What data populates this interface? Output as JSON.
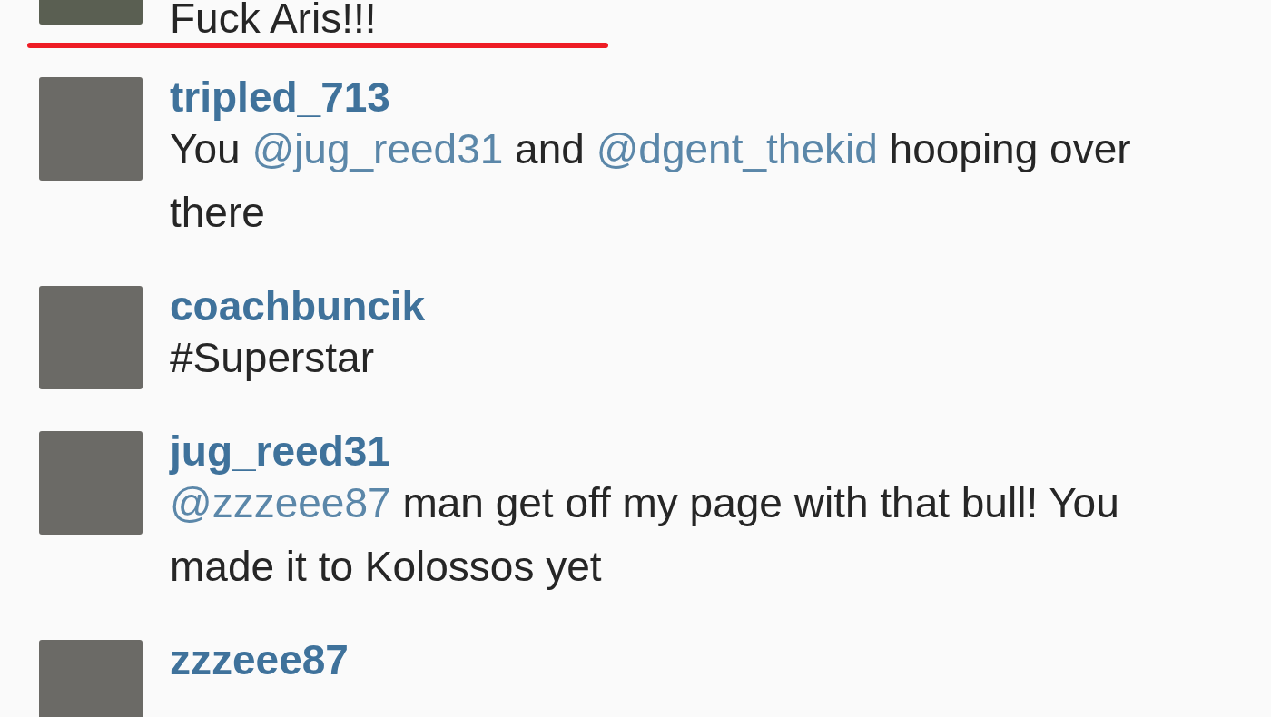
{
  "comments": [
    {
      "body": [
        {
          "kind": "text",
          "text": "Fuck Aris!!!"
        }
      ]
    },
    {
      "username": "tripled_713",
      "body": [
        {
          "kind": "text",
          "text": "You "
        },
        {
          "kind": "mention",
          "text": "@jug_reed31"
        },
        {
          "kind": "text",
          "text": " and "
        },
        {
          "kind": "mention",
          "text": "@dgent_thekid"
        },
        {
          "kind": "text",
          "text": " hooping over there"
        }
      ]
    },
    {
      "username": "coachbuncik",
      "body": [
        {
          "kind": "text",
          "text": "#Superstar"
        }
      ]
    },
    {
      "username": "jug_reed31",
      "body": [
        {
          "kind": "mention",
          "text": "@zzzeee87"
        },
        {
          "kind": "text",
          "text": " man get off my page with that bull! You made it to Kolossos yet"
        }
      ]
    },
    {
      "username": "zzzeee87"
    }
  ]
}
